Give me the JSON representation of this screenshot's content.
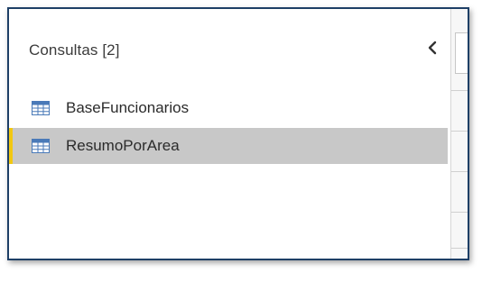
{
  "pane": {
    "title": "Consultas [2]",
    "collapse_icon": "chevron-left-icon"
  },
  "queries": [
    {
      "label": "BaseFuncionarios",
      "icon": "table-icon",
      "selected": false
    },
    {
      "label": "ResumoPorArea",
      "icon": "table-icon",
      "selected": true
    }
  ],
  "colors": {
    "selection_bg": "#c8c8c8",
    "selection_accent": "#f2c811",
    "frame_border": "#1e3f66",
    "table_icon": "#4a7ab8"
  }
}
